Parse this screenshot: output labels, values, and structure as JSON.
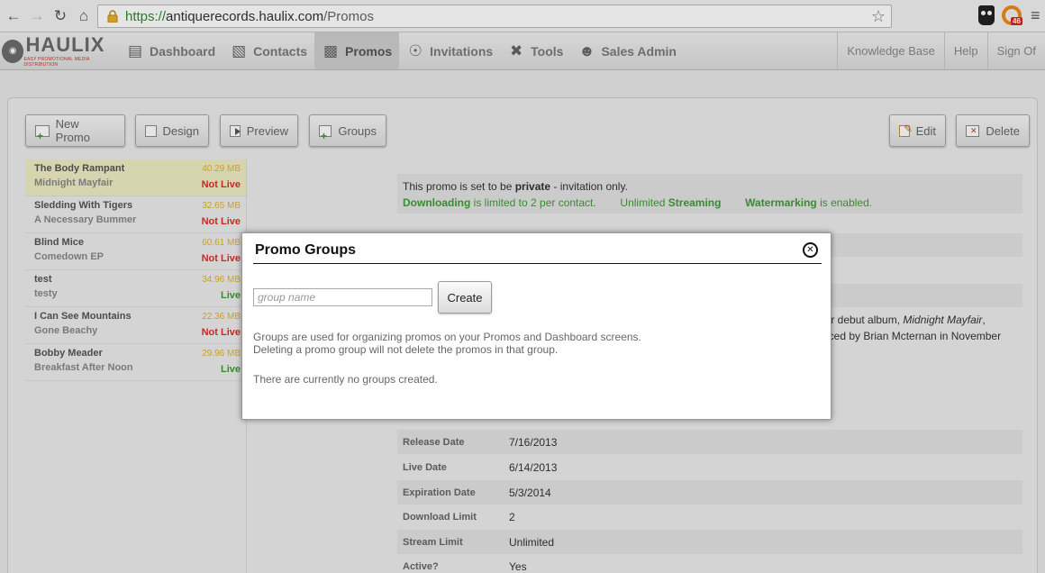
{
  "browser": {
    "url_scheme": "https://",
    "url_host": "antiquerecords.haulix.com",
    "url_path": "/Promos",
    "ext_badge": "46"
  },
  "header": {
    "logo_text": "HAULIX",
    "logo_tagline": "EASY PROMOTIONAL MEDIA DISTRIBUTION",
    "nav": [
      {
        "label": "Dashboard",
        "icon": "dashboard-icon"
      },
      {
        "label": "Contacts",
        "icon": "contacts-icon"
      },
      {
        "label": "Promos",
        "icon": "promos-icon",
        "active": true
      },
      {
        "label": "Invitations",
        "icon": "invitations-icon"
      },
      {
        "label": "Tools",
        "icon": "tools-icon"
      },
      {
        "label": "Sales Admin",
        "icon": "sales-admin-icon"
      }
    ],
    "right_links": [
      "Knowledge Base",
      "Help",
      "Sign Of"
    ]
  },
  "toolbar": {
    "new_promo": "New Promo",
    "design": "Design",
    "preview": "Preview",
    "groups": "Groups",
    "edit": "Edit",
    "delete": "Delete"
  },
  "promos": [
    {
      "title": "The Body Rampant",
      "artist": "Midnight Mayfair",
      "size": "40.29 MB",
      "status": "Not Live"
    },
    {
      "title": "Sledding With Tigers",
      "artist": "A Necessary Bummer",
      "size": "32.65 MB",
      "status": "Not Live"
    },
    {
      "title": "Blind Mice",
      "artist": "Comedown EP",
      "size": "60.61 MB",
      "status": "Not Live"
    },
    {
      "title": "test",
      "artist": "testy",
      "size": "34.96 MB",
      "status": "Live"
    },
    {
      "title": "I Can See Mountains",
      "artist": "Gone Beachy",
      "size": "22.36 MB",
      "status": "Not Live"
    },
    {
      "title": "Bobby Meader",
      "artist": "Breakfast After Noon",
      "size": "29.96 MB",
      "status": "Live"
    }
  ],
  "info": {
    "line1_pre": "This promo is set to be ",
    "line1_bold": "private",
    "line1_post": " - invitation only.",
    "downloading": "Downloading",
    "downloading_rest": " is limited to 2 per contact.",
    "unlimited": "Unlimited ",
    "streaming": "Streaming",
    "watermarking": "Watermarking",
    "watermarking_rest": " is enabled."
  },
  "description": {
    "fragment1_pre": "eir debut album, ",
    "fragment1_italic": "Midnight Mayfair",
    "fragment1_post": ",",
    "fragment2": "uced by Brian Mcternan in November"
  },
  "details": [
    {
      "label": "Release Date",
      "value": "7/16/2013"
    },
    {
      "label": "Live Date",
      "value": "6/14/2013"
    },
    {
      "label": "Expiration Date",
      "value": "5/3/2014"
    },
    {
      "label": "Download Limit",
      "value": "2"
    },
    {
      "label": "Stream Limit",
      "value": "Unlimited"
    },
    {
      "label": "Active?",
      "value": "Yes"
    }
  ],
  "modal": {
    "title": "Promo Groups",
    "input_placeholder": "group name",
    "create_label": "Create",
    "help_line1": "Groups are used for organizing promos on your Promos and Dashboard screens.",
    "help_line2": "Deleting a promo group will not delete the promos in that group.",
    "empty_message": "There are currently no groups created."
  }
}
